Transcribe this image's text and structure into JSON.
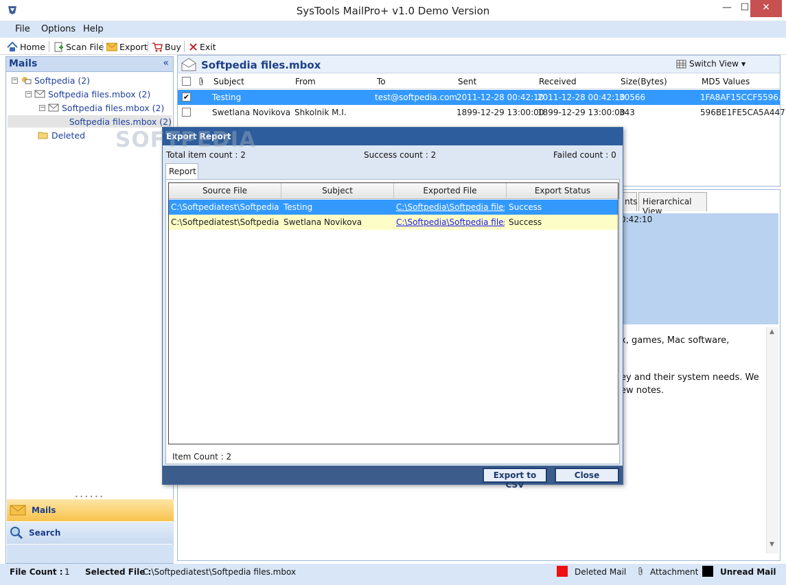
{
  "window": {
    "title": "SysTools MailPro+ v1.0 Demo Version"
  },
  "menu": {
    "file": "File",
    "options": "Options",
    "help": "Help"
  },
  "toolbar": {
    "home": "Home",
    "scan_file": "Scan File",
    "export": "Export",
    "buy": "Buy",
    "exit": "Exit"
  },
  "left": {
    "header": "Mails",
    "collapse": "«",
    "tree": [
      {
        "label": "Softpedia (2)"
      },
      {
        "label": "Softpedia files.mbox (2)"
      },
      {
        "label": "Softpedia files.mbox (2)"
      },
      {
        "label": "Softpedia files.mbox (2)"
      },
      {
        "label": "Deleted"
      }
    ],
    "nav": {
      "mails": "Mails",
      "search": "Search"
    }
  },
  "list": {
    "title": "Softpedia files.mbox",
    "switch_view": "Switch View",
    "columns": {
      "subject": "Subject",
      "from": "From",
      "to": "To",
      "sent": "Sent",
      "received": "Received",
      "size": "Size(Bytes)",
      "md5": "MD5 Values"
    },
    "rows": [
      {
        "checked": "✔",
        "subject": "Testing",
        "from": "",
        "to": "test@softpedia.com",
        "sent": "2011-12-28 00:42:10",
        "received": "2011-12-28 00:42:10",
        "size": "30566",
        "md5": "1FA8AF15CCF5596..."
      },
      {
        "checked": "",
        "subject": "Swetlana Novikova",
        "from": "Shkolnik M.I.",
        "to": "",
        "sent": "1899-12-29 13:00:00",
        "received": "1899-12-29 13:00:00",
        "size": "343",
        "md5": "596BE1FE5CA5A447..."
      }
    ]
  },
  "preview": {
    "tab_partial": "nts",
    "tab_hierarchical": "Hierarchical View",
    "meta_time": "0:42:10",
    "body_lines": [
      "x, games, Mac software,",
      "ey and their system needs. We",
      "ew notes."
    ]
  },
  "status": {
    "file_count_label": "File Count :",
    "file_count": "1",
    "selected_file_label": "Selected File :",
    "selected_file": "C:\\Softpediatest\\Softpedia files.mbox",
    "deleted_mail": "Deleted Mail",
    "attachment": "Attachment",
    "unread_mail": "Unread Mail"
  },
  "dialog": {
    "title": "Export Report",
    "total": "Total item count : 2",
    "success": "Success count :  2",
    "failed": "Failed count :  0",
    "tab": "Report",
    "columns": {
      "source": "Source File",
      "subject": "Subject",
      "exported": "Exported File",
      "status": "Export Status"
    },
    "rows": [
      {
        "source": "C:\\Softpediatest\\Softpedia f...",
        "subject": "Testing",
        "exported": "C:\\Softpedia\\Softpedia files...",
        "status": "Success"
      },
      {
        "source": "C:\\Softpediatest\\Softpedia f...",
        "subject": "Swetlana Novikova",
        "exported": "C:\\Softpedia\\Softpedia files...",
        "status": "Success"
      }
    ],
    "item_count": "Item Count :  2",
    "export_csv": "Export to CSV",
    "close": "Close"
  },
  "watermark": "SOFTPEDIA",
  "colors": {
    "accent": "#2d5d9c",
    "selected_row": "#3399ff",
    "alt_row": "#fdfdc8",
    "menu_bg": "#d8e6f7"
  }
}
